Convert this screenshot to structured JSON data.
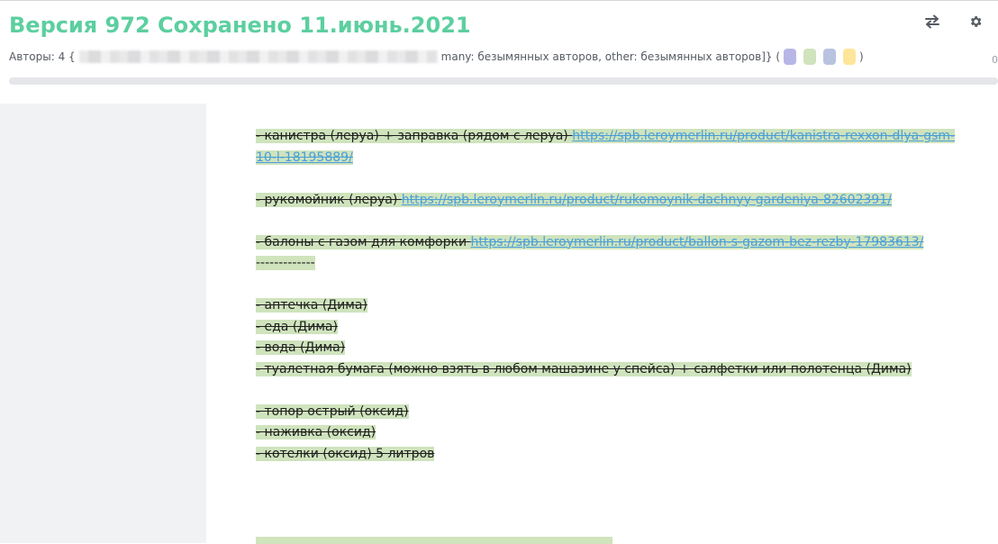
{
  "header": {
    "title": "Версия 972 Сохранено 11.июнь.2021",
    "authors_prefix": "Авторы: 4 {",
    "authors_suffix": "many: безымянных авторов, other: безымянных авторов]} (",
    "authors_close": ")",
    "corner_number": "0",
    "author_colors": [
      "#b8b6e6",
      "#cfe3bd",
      "#b9c3e0",
      "#fde59a"
    ]
  },
  "toolbar": {
    "swap_icon": "swap-arrows-icon",
    "settings_icon": "gear-icon"
  },
  "document": {
    "line1_text": "- канистра (леруа) + заправка (рядом с леруа) ",
    "line1_link": "https://spb.leroymerlin.ru/product/kanistra-rexxon-dlya-gsm-",
    "line1_link_cont": "10-l-18195889/",
    "line2_text": "- рукомойник (леруа) ",
    "line2_link": "https://spb.leroymerlin.ru/product/rukomoynik-dachnyy-gardeniya-82602391/",
    "line3_text": "- балоны с газом для комфорки ",
    "line3_link": "https://spb.leroymerlin.ru/product/ballon-s-gazom-bez-rezby-17983613/",
    "separator": "-------------",
    "item_aptechka": "- аптечка (Дима)",
    "item_eda": "- еда (Дима)",
    "item_voda": "- вода (Дима)",
    "item_tualet": "- туалетная бумага (можно взять в любом машазине у спейса) + салфетки или полотенца (Дима)",
    "item_topor": "- топор острый (оксид)",
    "item_nazhovka": "- наживка (оксид)",
    "item_kotelki": "- котелки (оксид) 5 литров"
  }
}
